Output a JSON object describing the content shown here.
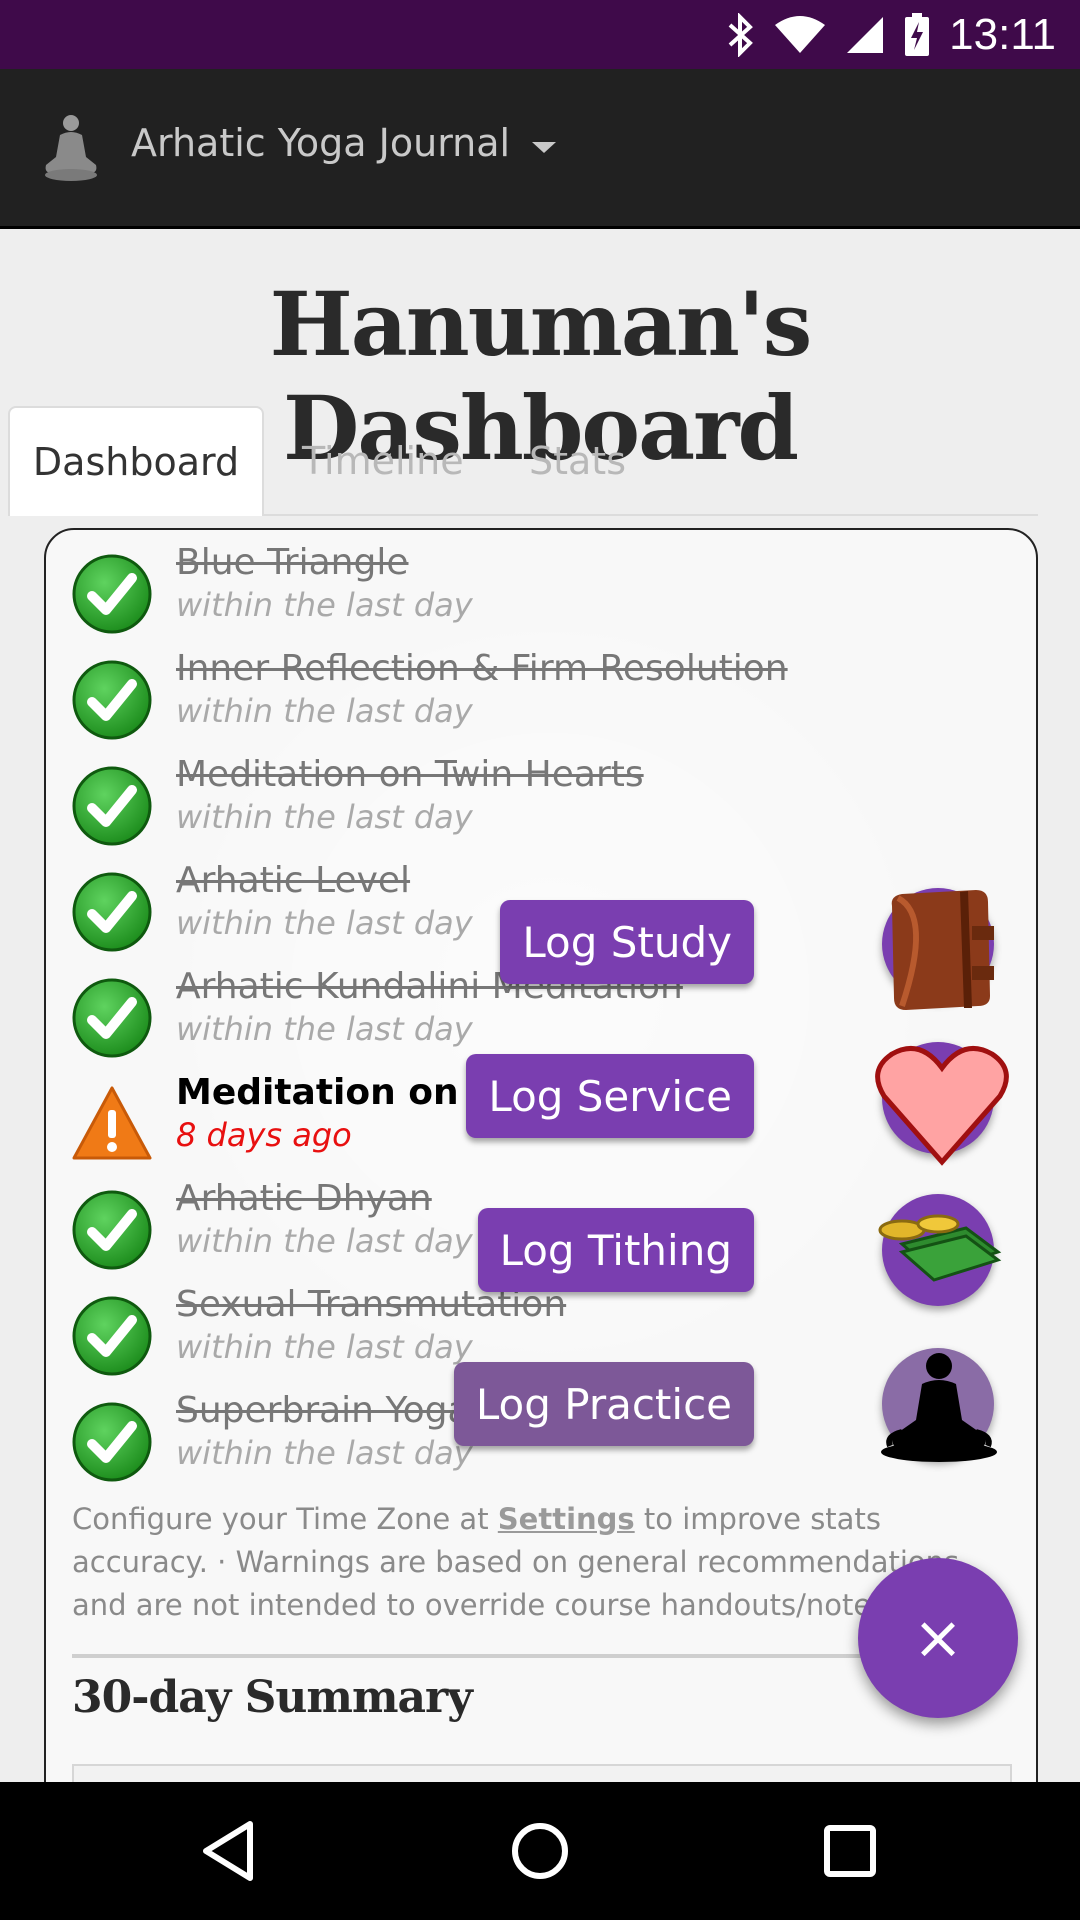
{
  "status_bar": {
    "time": "13:11",
    "icons": [
      "bluetooth-icon",
      "wifi-icon",
      "signal-icon",
      "battery-charging-icon"
    ]
  },
  "app_bar": {
    "title": "Arhatic Yoga Journal",
    "logo": "meditating-figure-icon",
    "menu": "dropdown-caret-icon"
  },
  "page": {
    "title": "Hanuman's Dashboard"
  },
  "tabs": [
    {
      "label": "Dashboard",
      "active": true
    },
    {
      "label": "Timeline",
      "active": false
    },
    {
      "label": "Stats",
      "active": false
    }
  ],
  "practices": [
    {
      "name": "Blue Triangle",
      "when": "within the last day",
      "status": "done"
    },
    {
      "name": "Inner Reflection & Firm Resolution",
      "when": "within the last day",
      "status": "done"
    },
    {
      "name": "Meditation on Twin Hearts",
      "when": "within the last day",
      "status": "done"
    },
    {
      "name": "Arhatic Level",
      "when": "within the last day",
      "status": "done"
    },
    {
      "name": "Arhatic Kundalini Meditation",
      "when": "within the last day",
      "status": "done"
    },
    {
      "name": "Meditation on the Blu",
      "when": "8 days ago",
      "status": "warning"
    },
    {
      "name": "Arhatic Dhyan",
      "when": "within the last day",
      "status": "done"
    },
    {
      "name": "Sexual Transmutation",
      "when": "within the last day",
      "status": "done"
    },
    {
      "name": "Superbrain Yoga",
      "when": "within the last day",
      "status": "done"
    }
  ],
  "note": {
    "prefix": "Configure your Time Zone at ",
    "link": "Settings",
    "suffix": " to improve stats accuracy. · Warnings are based on general recommendations and are not intended to override course handouts/notes."
  },
  "summary": {
    "title": "30-day Summary"
  },
  "speed_dial": {
    "actions": [
      {
        "label": "Log Study",
        "icon": "book-icon"
      },
      {
        "label": "Log Service",
        "icon": "heart-icon"
      },
      {
        "label": "Log Tithing",
        "icon": "money-icon"
      },
      {
        "label": "Log Practice",
        "icon": "meditation-icon"
      }
    ],
    "close_label": "×"
  },
  "colors": {
    "accent": "#7a3eb0",
    "status_bar": "#3f0a4a",
    "app_bar": "#212121",
    "warning_text": "#e81010"
  }
}
